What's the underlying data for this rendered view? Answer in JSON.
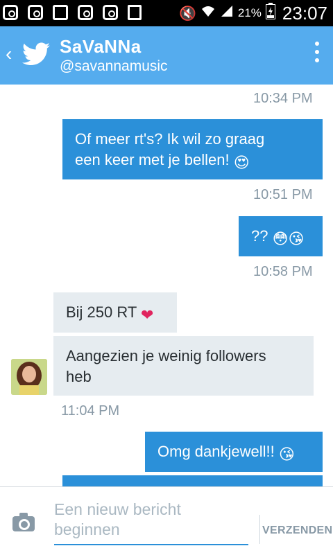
{
  "status_bar": {
    "battery_percent": "21%",
    "time": "23:07",
    "icons": [
      "instagram-icon",
      "instagram-icon",
      "mail-icon",
      "instagram-icon",
      "instagram-icon",
      "calendar-icon",
      "mute-icon",
      "wifi-icon",
      "signal-icon",
      "battery-icon"
    ]
  },
  "header": {
    "name": "SaVaNNa",
    "handle": "@savannamusic"
  },
  "colors": {
    "accent": "#55acee",
    "outgoing_bubble": "#2b90d9",
    "incoming_bubble": "#e6ecf0"
  },
  "messages": [
    {
      "type": "time",
      "text": "10:34 PM"
    },
    {
      "type": "out",
      "text": "Of meer rt's? Ik wil zo graag een keer met je bellen! 😍"
    },
    {
      "type": "time",
      "text": "10:51 PM"
    },
    {
      "type": "out",
      "text": "?? 😳😘"
    },
    {
      "type": "time",
      "text": "10:58 PM"
    },
    {
      "type": "in",
      "text": "Bij 250 RT ❤️"
    },
    {
      "type": "in",
      "text": "Aangezien je weinig followers heb"
    },
    {
      "type": "time",
      "text": "11:04 PM"
    },
    {
      "type": "out",
      "text": "Omg dankjewell!! 😘"
    }
  ],
  "m": {
    "t1": "10:34 PM",
    "b1_line1": "Of meer rt's? Ik wil zo graag",
    "b1_line2": "een keer met je bellen! ",
    "t2": "10:51 PM",
    "b2": "?? ",
    "t3": "10:58 PM",
    "b3": "Bij 250 RT ",
    "b4_line1": "Aangezien je weinig followers",
    "b4_line2": "heb",
    "t4": "11:04 PM",
    "b5": "Omg dankjewell!! "
  },
  "compose": {
    "placeholder": "Een nieuw bericht beginnen",
    "send_label": "VERZENDEN"
  }
}
